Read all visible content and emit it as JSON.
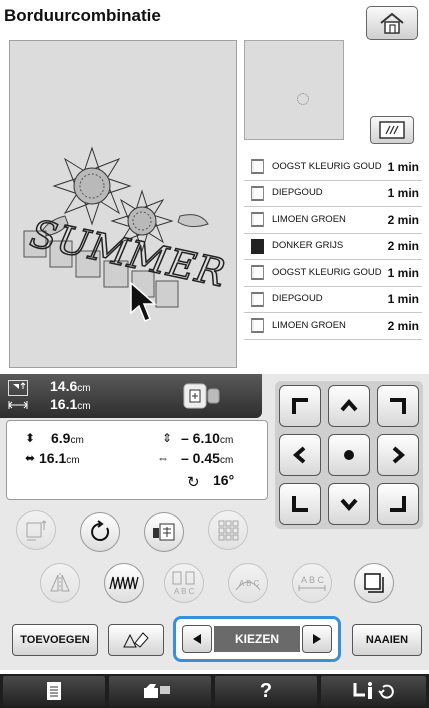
{
  "title": "Borduurcombinatie",
  "icons": {
    "home": "home-icon",
    "frame": "embroidery-frame-icon",
    "cursor": "arrow-cursor-icon"
  },
  "design_text": "SUMMER",
  "threads": [
    {
      "name": "OOGST KLEURIG GOUD",
      "time": "1 min",
      "dark": false
    },
    {
      "name": "DIEPGOUD",
      "time": "1 min",
      "dark": false
    },
    {
      "name": "LIMOEN GROEN",
      "time": "2 min",
      "dark": false
    },
    {
      "name": "DONKER GRIJS",
      "time": "2 min",
      "dark": true
    },
    {
      "name": "OOGST KLEURIG GOUD",
      "time": "1 min",
      "dark": false
    },
    {
      "name": "DIEPGOUD",
      "time": "1 min",
      "dark": false
    },
    {
      "name": "LIMOEN GROEN",
      "time": "2 min",
      "dark": false
    }
  ],
  "size": {
    "height_val": "14.6",
    "width_val": "16.1",
    "unit": "cm"
  },
  "info": {
    "h_val": "6.9",
    "w_val": "16.1",
    "v_offset": "– 6.10",
    "h_offset": "– 0.45",
    "unit": "cm",
    "rotation": "16°"
  },
  "buttons": {
    "add": "TOEVOEGEN",
    "select": "KIEZEN",
    "sew": "NAAIEN",
    "help": "?"
  },
  "accent_color": "#3d8ed8"
}
